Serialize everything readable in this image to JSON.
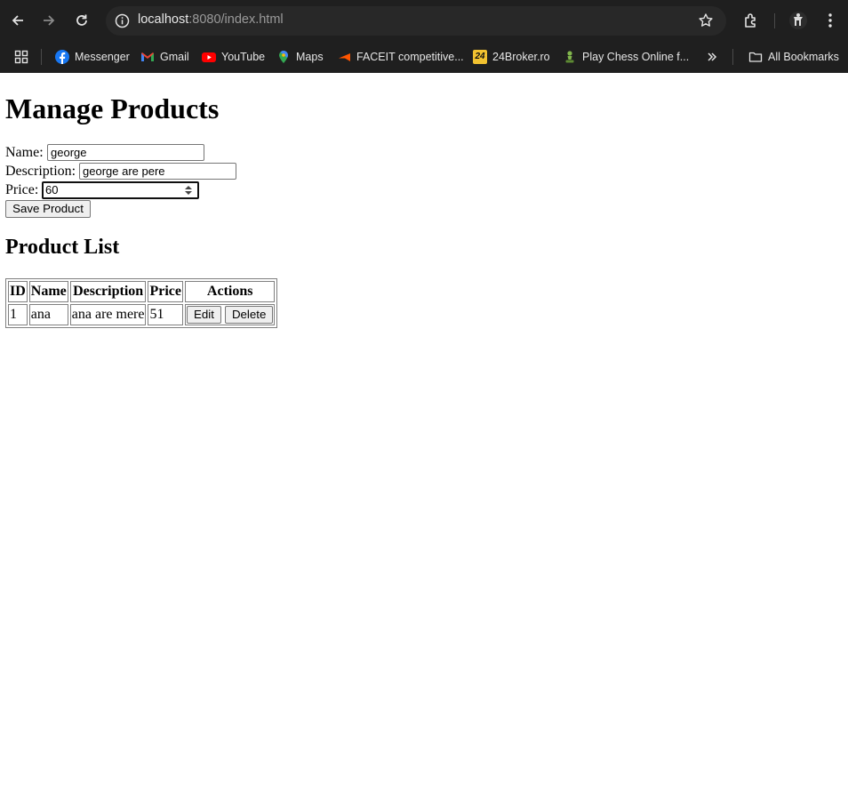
{
  "browser": {
    "url_host": "localhost",
    "url_rest": ":8080/index.html",
    "bookmarks": [
      {
        "label": "Messenger",
        "icon": "facebook-icon"
      },
      {
        "label": "Gmail",
        "icon": "gmail-icon"
      },
      {
        "label": "YouTube",
        "icon": "youtube-icon"
      },
      {
        "label": "Maps",
        "icon": "maps-icon"
      },
      {
        "label": "FACEIT competitive...",
        "icon": "faceit-icon"
      },
      {
        "label": "24Broker.ro",
        "icon": "broker-icon"
      },
      {
        "label": "Play Chess Online f...",
        "icon": "chess-icon"
      }
    ],
    "all_bookmarks": "All Bookmarks",
    "broker_icon_text": "24"
  },
  "page": {
    "title": "Manage Products",
    "form": {
      "name_label": "Name:",
      "name_value": "george",
      "description_label": "Description:",
      "description_value": "george are pere",
      "price_label": "Price:",
      "price_value": "60",
      "save_label": "Save Product"
    },
    "list_title": "Product List",
    "table": {
      "headers": [
        "ID",
        "Name",
        "Description",
        "Price",
        "Actions"
      ],
      "rows": [
        {
          "id": "1",
          "name": "ana",
          "description": "ana are mere",
          "price": "51",
          "edit": "Edit",
          "delete": "Delete"
        }
      ]
    }
  }
}
